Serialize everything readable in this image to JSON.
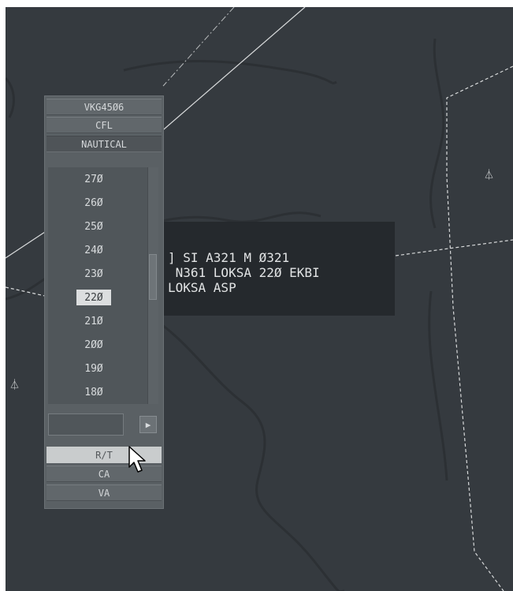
{
  "flight_label": {
    "line1": "] SI A321 M Ø321",
    "line2": " N361 LOKSA 22Ø EKBI",
    "line3": "LOKSA ASP"
  },
  "map_symbols": {
    "beacon_glyph": "⏃"
  },
  "cfl_menu": {
    "callsign": "VKG45Ø6",
    "title": "CFL",
    "unit": "NAUTICAL",
    "levels": [
      "27Ø",
      "26Ø",
      "25Ø",
      "24Ø",
      "23Ø",
      "22Ø",
      "21Ø",
      "2ØØ",
      "19Ø",
      "18Ø"
    ],
    "selected_level": "22Ø",
    "input_value": "",
    "enter_glyph": "▶",
    "actions": {
      "rt": "R/T",
      "ca": "CA",
      "va": "VA"
    }
  },
  "colors": {
    "radar_background": "#353a3f",
    "label_background": "#25292d",
    "menu_background": "#5a6064",
    "selected_level": "#dcdedf"
  }
}
